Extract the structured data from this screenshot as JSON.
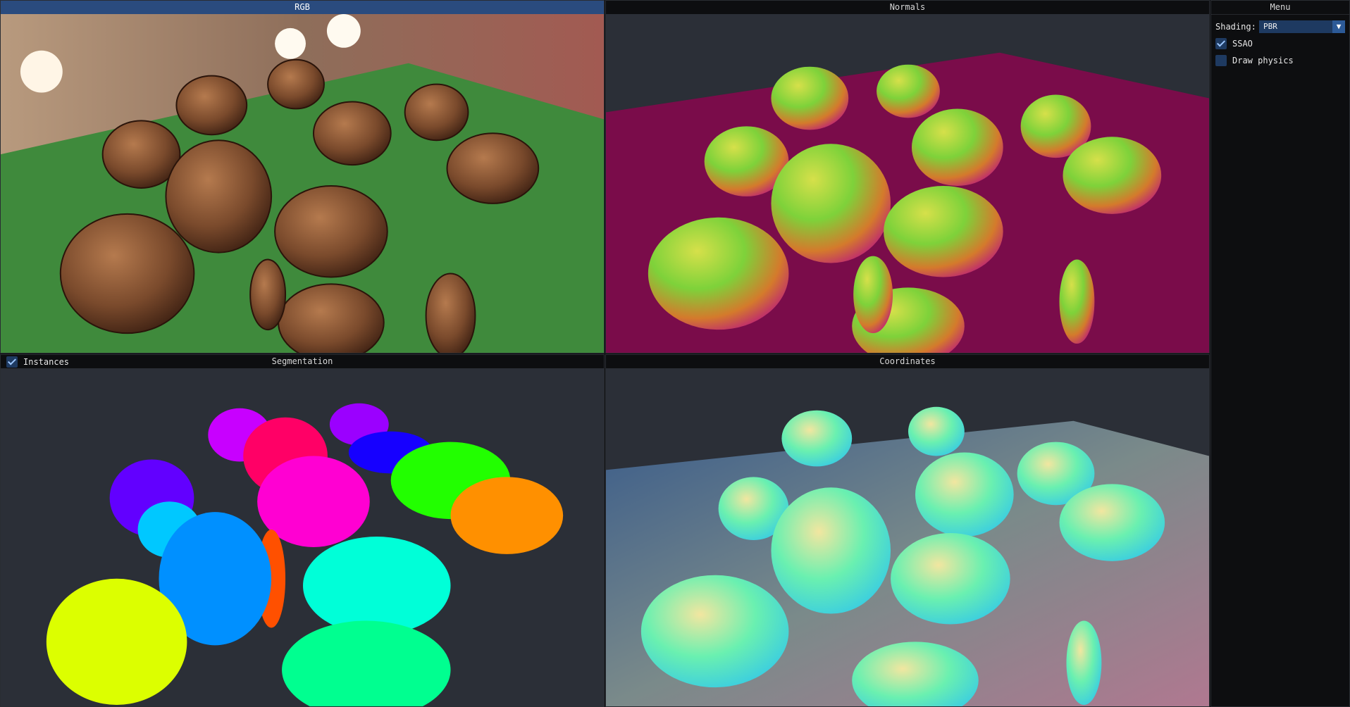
{
  "panels": {
    "rgb": {
      "title": "RGB"
    },
    "normals": {
      "title": "Normals"
    },
    "segmentation": {
      "title": "Segmentation",
      "instances_label": "Instances",
      "instances_checked": true
    },
    "coordinates": {
      "title": "Coordinates"
    }
  },
  "menu": {
    "title": "Menu",
    "shading_label": "Shading:",
    "shading_value": "PBR",
    "ssao_label": "SSAO",
    "ssao_checked": true,
    "draw_physics_label": "Draw physics",
    "draw_physics_checked": false
  },
  "colors": {
    "active_title": "#2a4b7e",
    "widget_bg": "#1e3a61",
    "viewport_bg": "#2b2f37"
  }
}
